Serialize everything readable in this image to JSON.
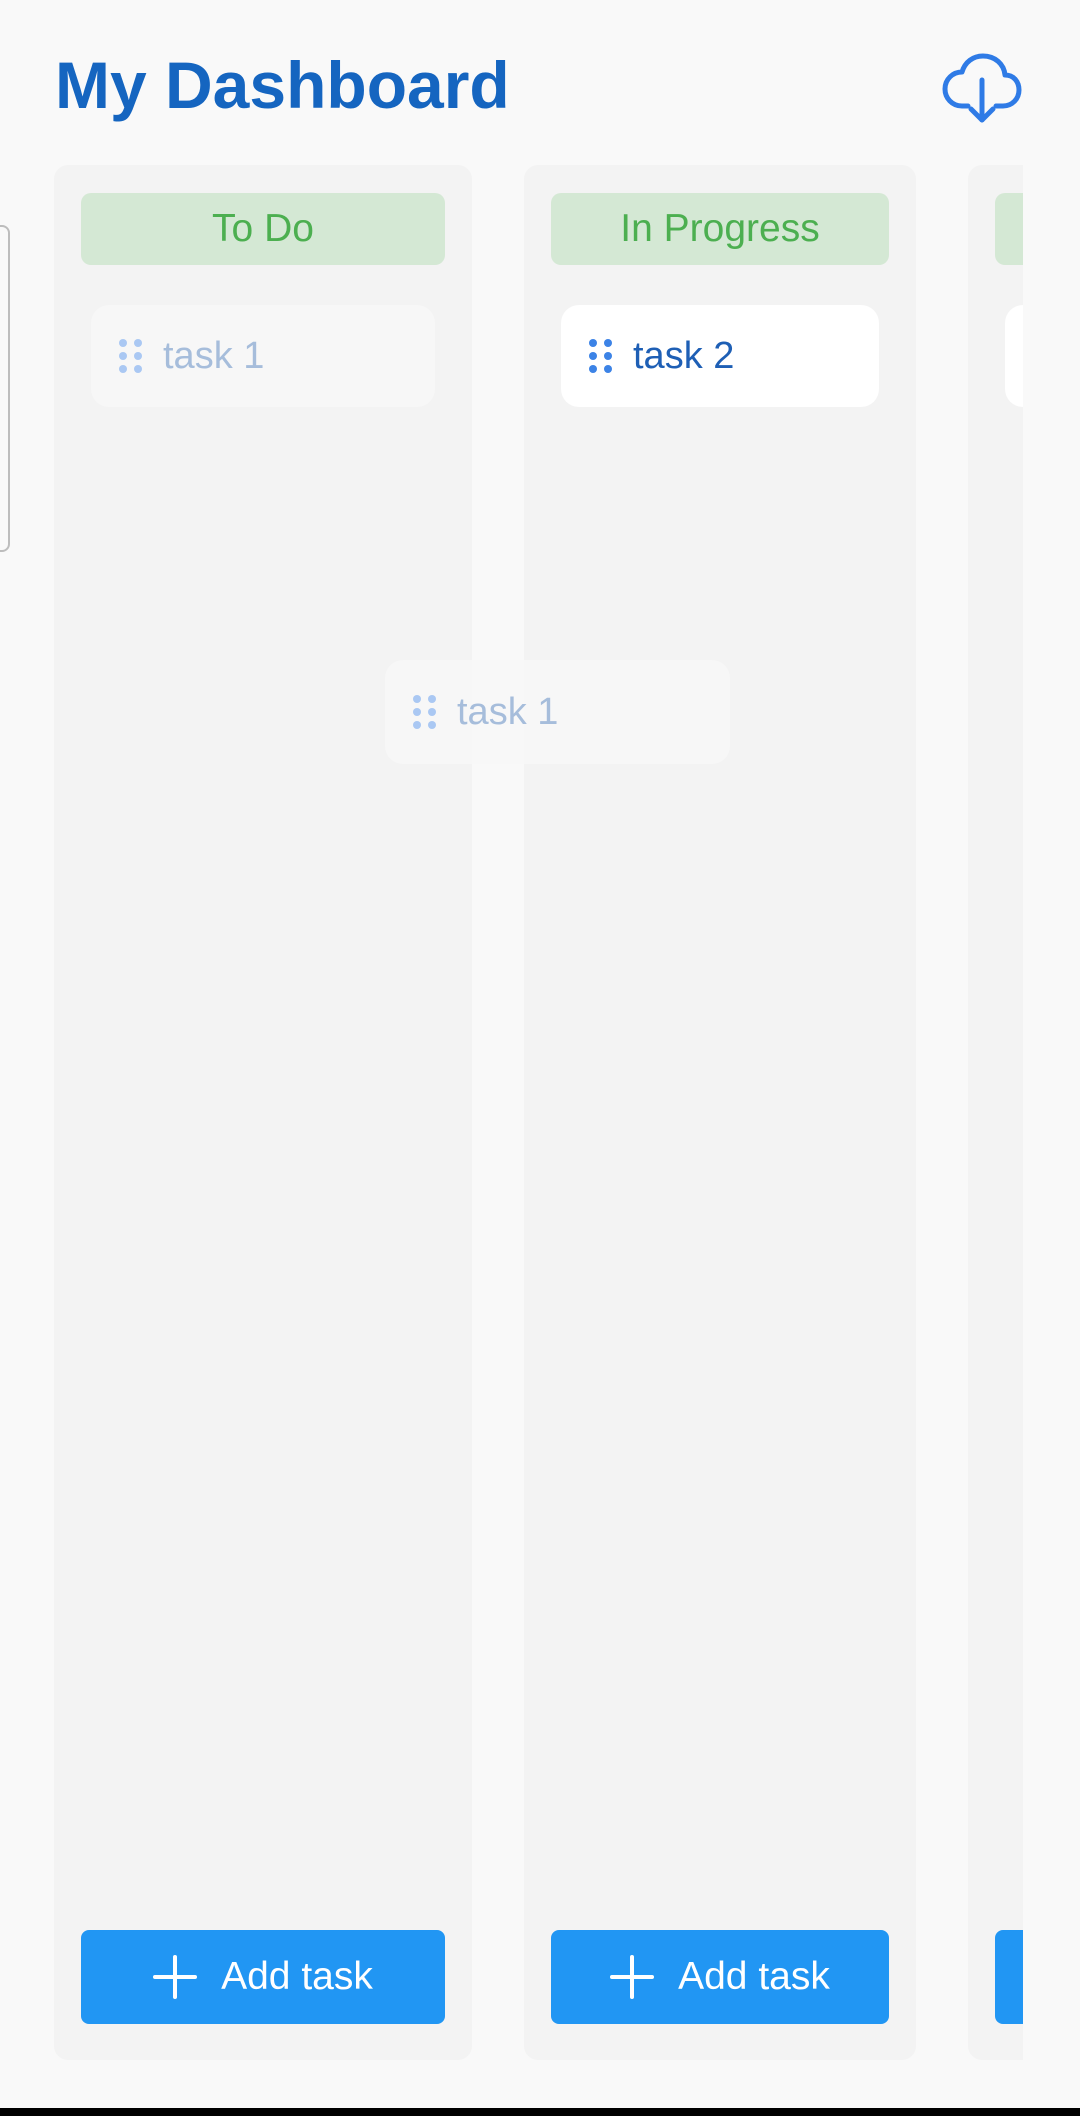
{
  "header": {
    "title": "My Dashboard",
    "download_icon": "cloud-download-icon",
    "accent_color": "#1565c0"
  },
  "columns": [
    {
      "title": "To Do",
      "tasks": [
        {
          "label": "task 1",
          "state": "placeholder-being-dragged"
        }
      ],
      "add_label": "Add task"
    },
    {
      "title": "In Progress",
      "tasks": [
        {
          "label": "task 2"
        }
      ],
      "add_label": "Add task"
    },
    {
      "title": "",
      "tasks": [
        {
          "label": ""
        }
      ],
      "add_label": ""
    }
  ],
  "drag_preview": {
    "label": "task 1"
  },
  "colors": {
    "header_bg": "#d4e8d4",
    "header_text": "#4caf50",
    "button_bg": "#2196f3",
    "task_text": "#1e5fb5",
    "grip": "#3c83e6"
  }
}
